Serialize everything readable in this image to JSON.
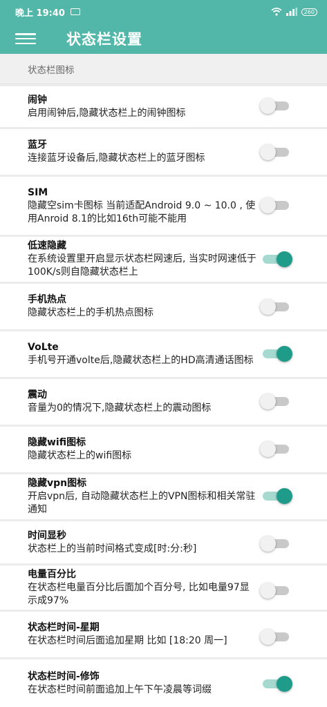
{
  "status_bar": {
    "time": "晚上 19:40",
    "battery": "260"
  },
  "app_bar": {
    "title": "状态栏设置"
  },
  "section": {
    "header": "状态栏图标"
  },
  "colors": {
    "accent": "#52b7a8",
    "toggle_on": "#1f9b8a"
  },
  "settings": [
    {
      "title": "闹钟",
      "desc": "启用闹钟后,隐藏状态栏上的闹钟图标",
      "enabled": false
    },
    {
      "title": "蓝牙",
      "desc": "连接蓝牙设备后,隐藏状态栏上的蓝牙图标",
      "enabled": false
    },
    {
      "title": "SIM",
      "desc": "隐藏空sim卡图标 当前适配Android 9.0 ~ 10.0 , 使用Anroid 8.1的比如16th可能不能用",
      "enabled": false
    },
    {
      "title": "低速隐藏",
      "desc": "在系统设置里开启显示状态栏网速后, 当实时网速低于100K/s则自隐藏状态栏上",
      "enabled": true
    },
    {
      "title": "手机热点",
      "desc": "隐藏状态栏上的手机热点图标",
      "enabled": false
    },
    {
      "title": "VoLte",
      "desc": "手机号开通volte后,隐藏状态栏上的HD高清通话图标",
      "enabled": true
    },
    {
      "title": "震动",
      "desc": "音量为0的情况下,隐藏状态栏上的震动图标",
      "enabled": false
    },
    {
      "title": "隐藏wifi图标",
      "desc": "隐藏状态栏上的wifi图标",
      "enabled": false
    },
    {
      "title": "隐藏vpn图标",
      "desc": "开启vpn后, 自动隐藏状态栏上的VPN图标和相关常驻通知",
      "enabled": true
    },
    {
      "title": "时间显秒",
      "desc": "状态栏上的当前时间格式变成[时:分:秒]",
      "enabled": false
    },
    {
      "title": "电量百分比",
      "desc": "在状态栏电量百分比后面加个百分号, 比如电量97显示成97%",
      "enabled": false
    },
    {
      "title": "状态栏时间-星期",
      "desc": "在状态栏时间后面追加星期 比如 [18:20 周一]",
      "enabled": false
    },
    {
      "title": "状态栏时间-修饰",
      "desc": "在状态栏时间前面追加上午下午凌晨等词缀",
      "enabled": true
    }
  ]
}
